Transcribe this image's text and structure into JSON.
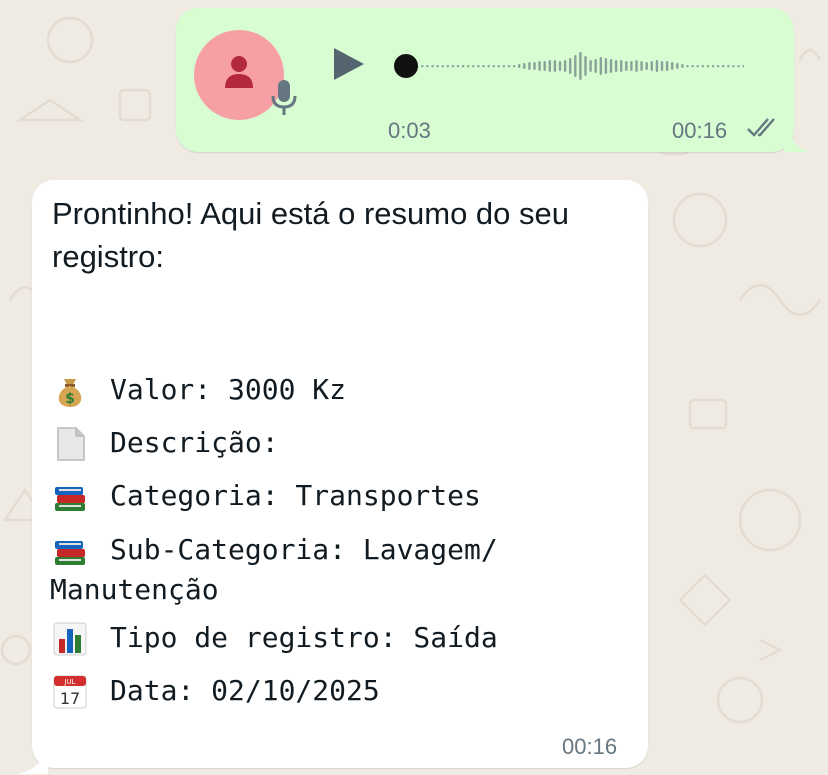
{
  "voice_message": {
    "duration": "0:03",
    "time": "00:16",
    "status": "read",
    "avatar_color": "#f6a0a6",
    "bubble_color": "#d9fdd3"
  },
  "reply_message": {
    "intro": "Prontinho! Aqui está o resumo do seu registro:",
    "lines": {
      "valor": "Valor: 3000 Kz",
      "descricao": "Descrição:",
      "categoria": "Categoria: Transportes",
      "subcategoria_1": "Sub-Categoria: Lavagem/",
      "subcategoria_2": "Manutenção",
      "tipo": "Tipo de registro: Saída",
      "data": "Data: 02/10/2025"
    },
    "icons": {
      "valor": "money-bag-icon",
      "descricao": "page-icon",
      "categoria": "books-icon",
      "subcategoria": "books-icon",
      "tipo": "bar-chart-icon",
      "data": "calendar-icon"
    },
    "calendar_icon_text": {
      "month": "JUL",
      "day": "17"
    },
    "time": "00:16"
  },
  "colors": {
    "wallpaper": "#efeae2",
    "meta_text": "#667781",
    "read_ticks": "#667781"
  }
}
